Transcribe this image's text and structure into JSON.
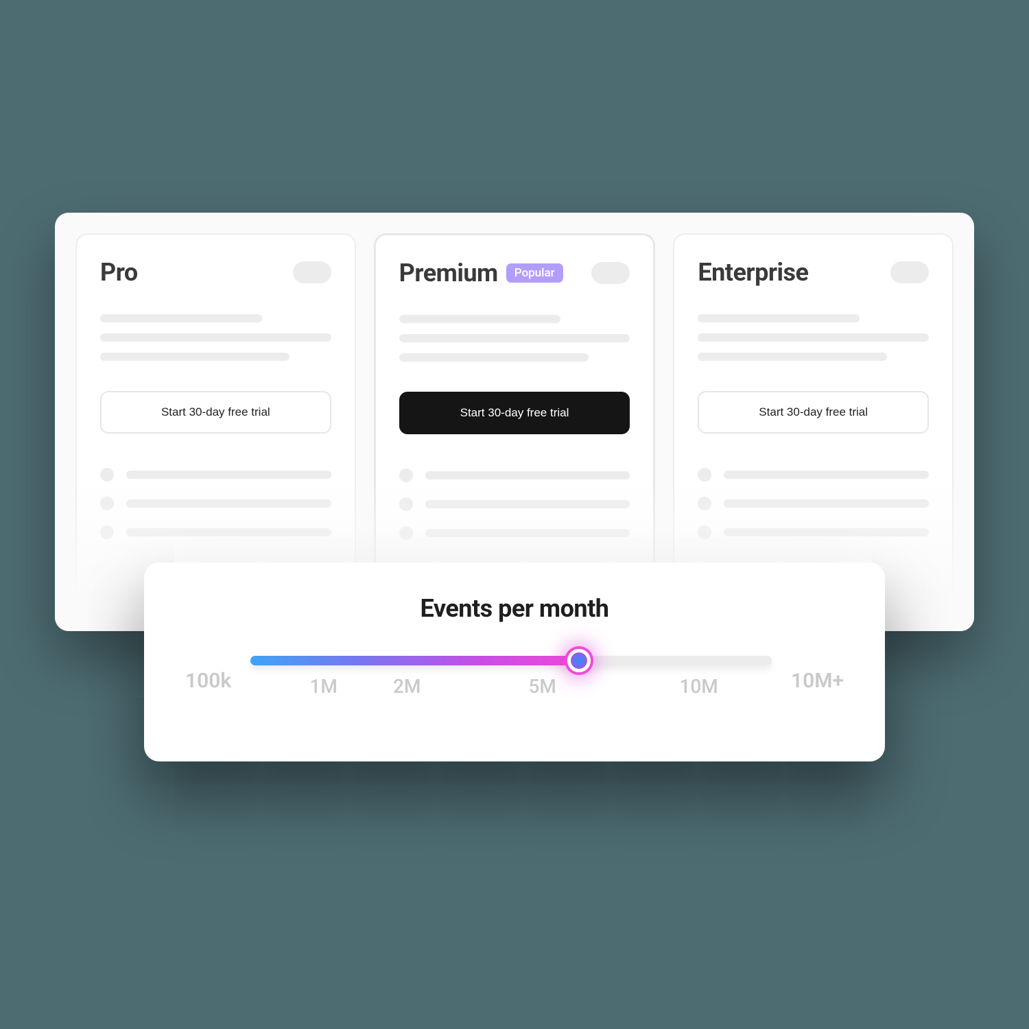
{
  "plans": [
    {
      "title": "Pro",
      "badge": null,
      "cta": "Start 30-day free trial",
      "featured": false
    },
    {
      "title": "Premium",
      "badge": "Popular",
      "cta": "Start 30-day free trial",
      "featured": true
    },
    {
      "title": "Enterprise",
      "badge": null,
      "cta": "Start 30-day free trial",
      "featured": false
    }
  ],
  "slider": {
    "title": "Events per month",
    "min_label": "100k",
    "max_label": "10M+",
    "ticks": [
      {
        "label": "1M",
        "pos": 14
      },
      {
        "label": "2M",
        "pos": 30
      },
      {
        "label": "5M",
        "pos": 56
      },
      {
        "label": "10M",
        "pos": 86
      }
    ],
    "value_pos": 63
  }
}
